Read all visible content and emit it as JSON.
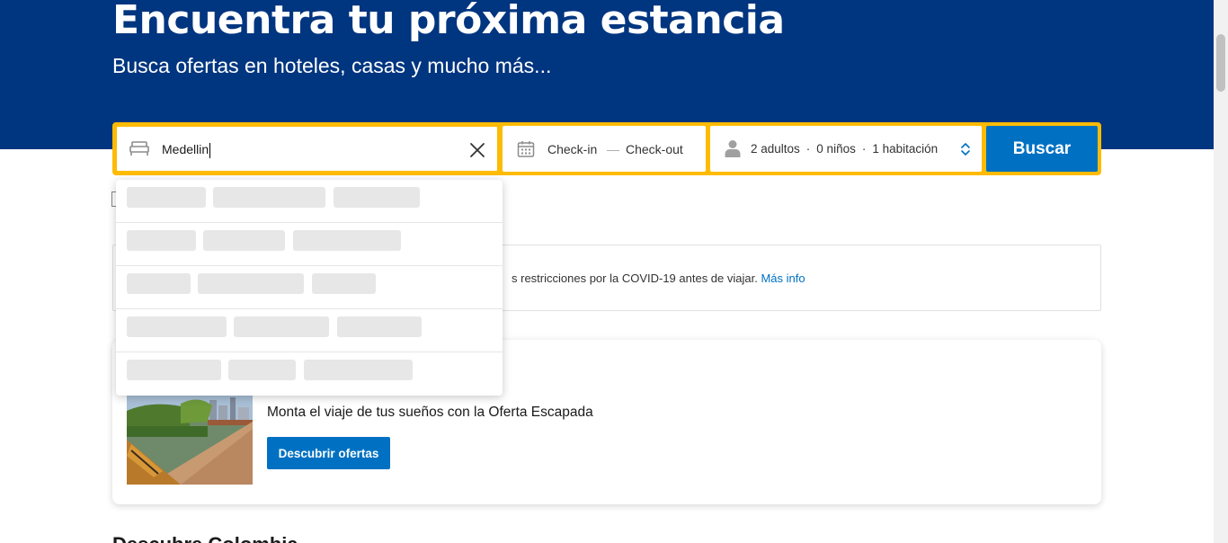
{
  "hero": {
    "title": "Encuentra tu próxima estancia",
    "subtitle": "Busca ofertas en hoteles, casas y mucho más..."
  },
  "search": {
    "destination_value": "Medellin",
    "checkin_label": "Check-in",
    "date_separator": "—",
    "checkout_label": "Check-out",
    "adults": "2 adultos",
    "children": "0 niños",
    "rooms": "1 habitación",
    "separator_dot": "·",
    "button_label": "Buscar"
  },
  "notice": {
    "text": "s restricciones por la COVID-19 antes de viajar.",
    "link_label": "Más info"
  },
  "promo": {
    "text": "Monta el viaje de tus sueños con la Oferta Escapada",
    "button_label": "Descubrir ofertas"
  },
  "section": {
    "heading": "Descubre Colombia"
  },
  "colors": {
    "brand_blue": "#003580",
    "accent_yellow": "#febb02",
    "button_blue": "#0071c2"
  },
  "icons": {
    "destination": "bed-icon",
    "clear": "close-icon",
    "dates": "calendar-icon",
    "guests": "person-icon",
    "guests_toggle": "chevron-updown-icon"
  },
  "autocomplete": {
    "state": "loading",
    "rows": 5
  }
}
